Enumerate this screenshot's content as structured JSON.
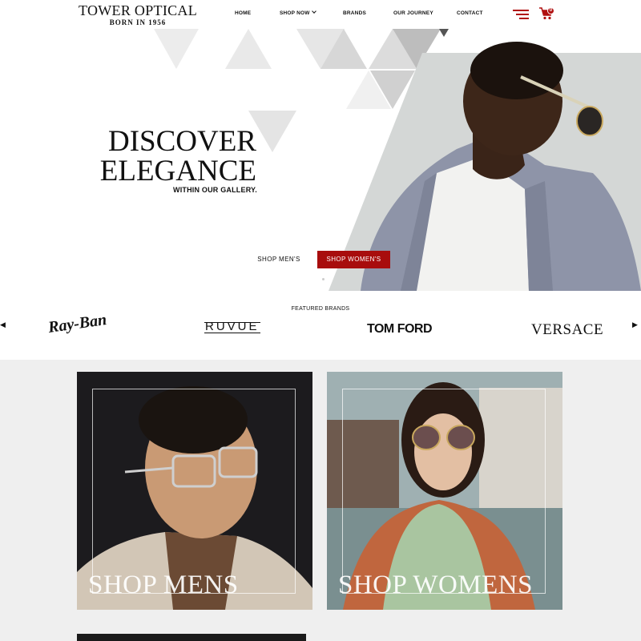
{
  "header": {
    "logo_main": "TOWER OPTICAL",
    "logo_sub": "BORN IN 1956",
    "nav": [
      {
        "label": "HOME"
      },
      {
        "label": "SHOP NOW"
      },
      {
        "label": "BRANDS"
      },
      {
        "label": "OUR JOURNEY"
      },
      {
        "label": "CONTACT"
      }
    ],
    "cart_count": "0",
    "accent": "#b01010"
  },
  "hero": {
    "title_line1": "DISCOVER",
    "title_line2": "ELEGANCE",
    "subtitle": "WITHIN OUR GALLERY.",
    "btn_men": "SHOP MEN'S",
    "btn_women": "SHOP WOMEN'S",
    "button_color": "#a80d0d"
  },
  "brands": {
    "title": "FEATURED BRANDS",
    "prev_icon": "◀",
    "next_icon": "▶",
    "items": [
      {
        "name": "Ray-Ban"
      },
      {
        "name": "RUVUE"
      },
      {
        "name": "TOM FORD"
      },
      {
        "name": "VERSACE"
      }
    ]
  },
  "categories": {
    "men_label": "SHOP MENS",
    "women_label": "SHOP WOMENS"
  }
}
